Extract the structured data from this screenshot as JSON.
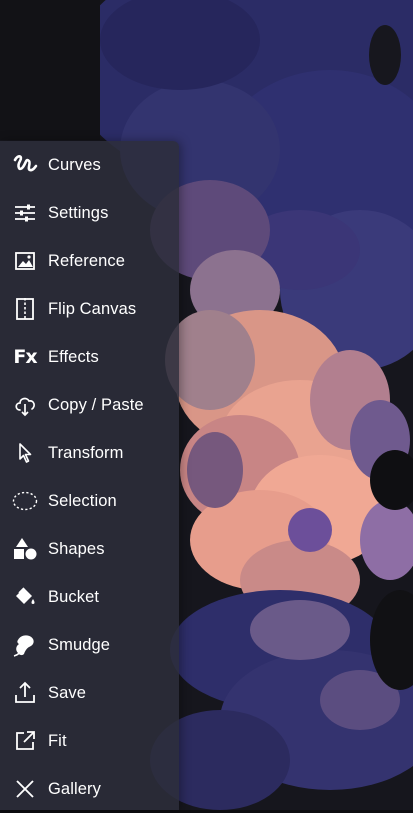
{
  "menu": {
    "items": [
      {
        "label": "Curves",
        "icon": "curves-icon"
      },
      {
        "label": "Settings",
        "icon": "sliders-icon"
      },
      {
        "label": "Reference",
        "icon": "image-icon"
      },
      {
        "label": "Flip Canvas",
        "icon": "flip-canvas-icon"
      },
      {
        "label": "Effects",
        "icon": "fx-icon",
        "icon_text": "Fx"
      },
      {
        "label": "Copy / Paste",
        "icon": "cloud-download-icon"
      },
      {
        "label": "Transform",
        "icon": "pointer-arrow-icon"
      },
      {
        "label": "Selection",
        "icon": "dashed-ellipse-icon"
      },
      {
        "label": "Shapes",
        "icon": "shapes-icon"
      },
      {
        "label": "Bucket",
        "icon": "paint-bucket-icon"
      },
      {
        "label": "Smudge",
        "icon": "smudge-icon"
      },
      {
        "label": "Save",
        "icon": "upload-icon"
      },
      {
        "label": "Fit",
        "icon": "external-link-icon"
      },
      {
        "label": "Gallery",
        "icon": "close-icon"
      }
    ]
  },
  "colors": {
    "menu_bg": "#2c2d3a",
    "menu_text": "#ffffff",
    "paint_navy": "#2e2f6e",
    "paint_peach": "#f2a48f",
    "paint_mauve": "#8a6a8c",
    "paint_violet": "#6a4f95"
  }
}
